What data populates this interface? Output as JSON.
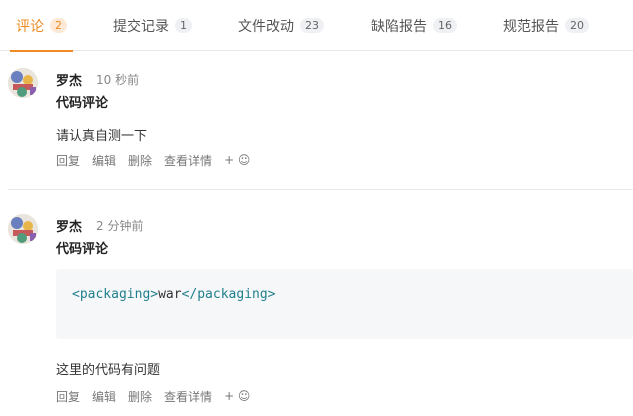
{
  "tabs": [
    {
      "label": "评论",
      "count": "2"
    },
    {
      "label": "提交记录",
      "count": "1"
    },
    {
      "label": "文件改动",
      "count": "23"
    },
    {
      "label": "缺陷报告",
      "count": "16"
    },
    {
      "label": "规范报告",
      "count": "20"
    }
  ],
  "active_tab": "评论",
  "accent_color": "#f08a24",
  "comments": [
    {
      "author": "罗杰",
      "time": "10 秒前",
      "title": "代码评论",
      "text": "请认真自测一下",
      "actions": [
        "回复",
        "编辑",
        "删除",
        "查看详情",
        "+ ☺"
      ]
    },
    {
      "author": "罗杰",
      "time": "2 分钟前",
      "title": "代码评论",
      "code": {
        "open_tag": "<packaging>",
        "content": "war",
        "close_tag": "</packaging>"
      },
      "text": "这里的代码有问题",
      "actions": [
        "回复",
        "编辑",
        "删除",
        "查看详情",
        "+ ☺"
      ]
    }
  ]
}
